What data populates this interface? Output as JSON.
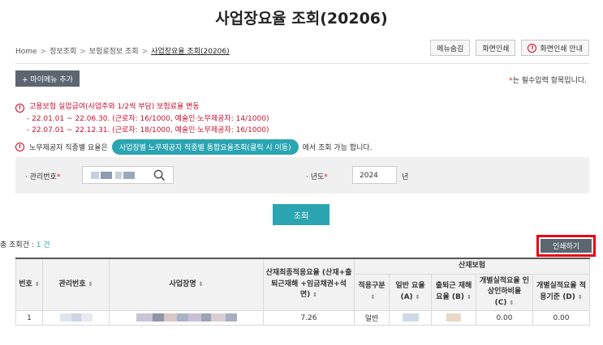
{
  "page": {
    "title": "사업장요율 조회(20206)"
  },
  "breadcrumb": {
    "items": [
      "Home",
      "정보조회",
      "보험료정보 조회"
    ],
    "current": "사업장요율 조회(20206)"
  },
  "top_buttons": {
    "hide_menu": "메뉴숨김",
    "print_screen": "화면인쇄",
    "print_guide": "화면인쇄 안내"
  },
  "toolbar": {
    "add_my_menu": "+ 마이메뉴 추가",
    "required_star": "*",
    "required_note": "는 필수입력 항목입니다."
  },
  "notices": {
    "line1": "고용보험 실업급여(사업주와 1/2씩 부담) 보험료율 변동",
    "line2": "- 22.01.01 ~ 22.06.30. (근로자: 16/1000, 예술인·노무제공자: 14/1000)",
    "line3": "- 22.07.01 ~ 22.12.31. (근로자: 18/1000, 예술인·노무제공자: 16/1000)",
    "line4_prefix": "노무제공자 직종별 요율은",
    "line4_link": "사업장별 노무제공자 직종별 통합요율조회(클릭 시 이동)",
    "line4_suffix": "에서 조회 가능 합니다."
  },
  "search": {
    "mgmt_label": "· 관리번호",
    "year_label": "· 년도",
    "year_value": "2024",
    "year_unit": "년",
    "required_mark": "*"
  },
  "query_button": "조회",
  "result": {
    "total_prefix": "총 조회건 : ",
    "total_count": "1 건",
    "print_button": "인쇄하기"
  },
  "table": {
    "headers": {
      "no": "번호",
      "mgmt_no": "관리번호",
      "biz_name": "사업장명",
      "final_rate": "산재최종적용요율 (산재+출퇴근재해 +임금채권+석면)",
      "group": "산재보험",
      "apply_type": "적용구분",
      "general_rate": "일반 요율 (A)",
      "commute_rate": "출퇴근 재해요율 (B)",
      "perf_discount": "개별실적요율 인상인하비율 (C)",
      "perf_basis": "개별실적요율 적용기준 (D)"
    },
    "rows": [
      {
        "no": "1",
        "final_rate": "7.26",
        "apply_type": "일반",
        "perf_discount": "0.00",
        "perf_basis": "0.00"
      }
    ]
  },
  "icons": {
    "search": "search-icon",
    "alert": "alert-circle-icon",
    "sort": "sort-icon"
  },
  "colors": {
    "accent_teal": "#2ba5b2",
    "dark_button": "#5c6670",
    "notice_red": "#c8102e",
    "highlight_red": "#e60012"
  }
}
